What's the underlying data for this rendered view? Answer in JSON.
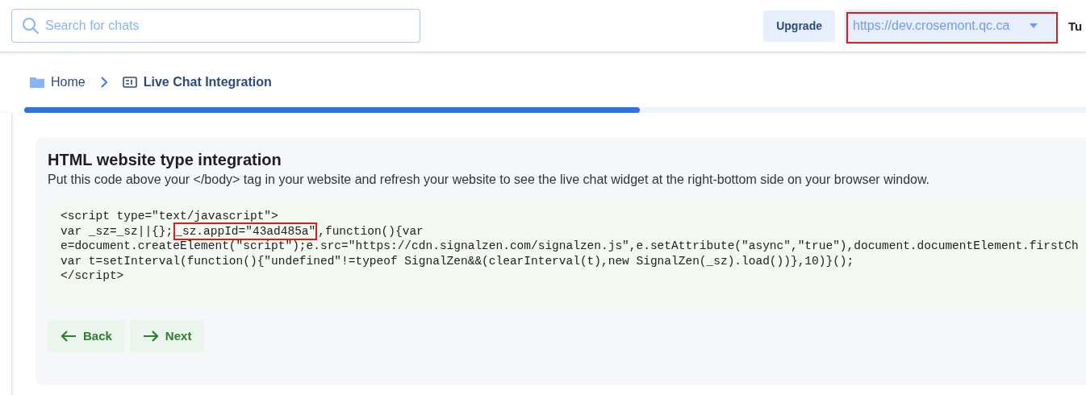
{
  "header": {
    "search": {
      "placeholder": "Search for chats"
    },
    "upgrade_button": "Upgrade",
    "site_select": {
      "value": "https://dev.crosemont.qc.ca",
      "highlighted": true
    },
    "user_name": "Tu"
  },
  "breadcrumb": [
    {
      "label": "Home",
      "kind": "folder"
    },
    {
      "label": "Live Chat Integration",
      "kind": "page"
    }
  ],
  "progress": {
    "level": 0.58
  },
  "card": {
    "title": "HTML website type integration",
    "description": "Put this code above your </body> tag in your website and refresh your website to see the live chat widget at the right-bottom side on your browser window.",
    "code_lines": [
      [
        {
          "text": "<script type=\"text/javascript\">",
          "highlighted": false
        }
      ],
      [
        {
          "text": "var _sz=_sz||{};",
          "highlighted": false
        },
        {
          "text": "_sz.appId=\"43ad485a\"",
          "highlighted": true
        },
        {
          "text": ",function(){var",
          "highlighted": false
        }
      ],
      [
        {
          "text": "e=document.createElement(\"script\");e.src=\"https://cdn.signalzen.com/signalzen.js\",e.setAttribute(\"async\",\"true\"),document.documentElement.firstCh",
          "highlighted": false
        }
      ],
      [
        {
          "text": "var t=setInterval(function(){\"undefined\"!=typeof SignalZen&&(clearInterval(t),new SignalZen(_sz).load())},10)}();",
          "highlighted": false
        }
      ],
      [
        {
          "text": "</script>",
          "highlighted": false
        }
      ]
    ],
    "buttons": [
      {
        "label": "Back",
        "kind": "back"
      },
      {
        "label": "Next",
        "kind": "next"
      }
    ]
  }
}
